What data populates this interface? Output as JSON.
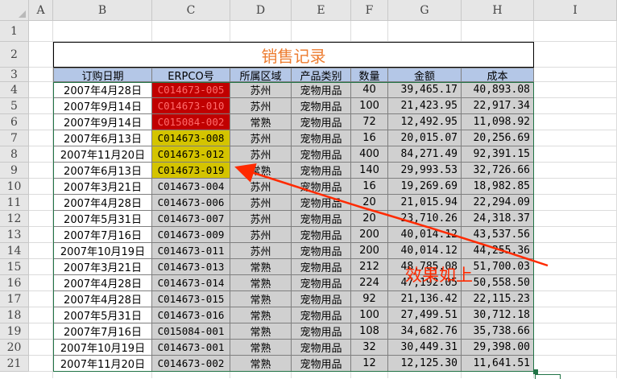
{
  "columns": [
    "A",
    "B",
    "C",
    "D",
    "E",
    "F",
    "G",
    "H",
    "I"
  ],
  "rows": [
    "1",
    "2",
    "3",
    "4",
    "5",
    "6",
    "7",
    "8",
    "9",
    "10",
    "11",
    "12",
    "13",
    "14",
    "15",
    "16",
    "17",
    "18",
    "19",
    "20",
    "21"
  ],
  "title": "销售记录",
  "headers": [
    "订购日期",
    "ERPCO号",
    "所属区域",
    "产品类别",
    "数量",
    "金额",
    "成本"
  ],
  "data": [
    [
      "2007年4月28日",
      "C014673-005",
      "苏州",
      "宠物用品",
      "40",
      "39,465.17",
      "40,893.08"
    ],
    [
      "2007年9月14日",
      "C014673-010",
      "苏州",
      "宠物用品",
      "100",
      "21,423.95",
      "22,917.34"
    ],
    [
      "2007年9月14日",
      "C015084-002",
      "常熟",
      "宠物用品",
      "72",
      "12,492.95",
      "11,098.92"
    ],
    [
      "2007年6月13日",
      "C014673-008",
      "苏州",
      "宠物用品",
      "16",
      "20,015.07",
      "20,256.69"
    ],
    [
      "2007年11月20日",
      "C014673-012",
      "苏州",
      "宠物用品",
      "400",
      "84,271.49",
      "92,391.15"
    ],
    [
      "2007年6月13日",
      "C014673-019",
      "常熟",
      "宠物用品",
      "140",
      "29,993.53",
      "32,726.66"
    ],
    [
      "2007年3月21日",
      "C014673-004",
      "苏州",
      "宠物用品",
      "16",
      "19,269.69",
      "18,982.85"
    ],
    [
      "2007年4月28日",
      "C014673-006",
      "苏州",
      "宠物用品",
      "20",
      "21,015.94",
      "22,294.09"
    ],
    [
      "2007年5月31日",
      "C014673-007",
      "苏州",
      "宠物用品",
      "20",
      "23,710.26",
      "24,318.37"
    ],
    [
      "2007年7月16日",
      "C014673-009",
      "苏州",
      "宠物用品",
      "200",
      "40,014.12",
      "43,537.56"
    ],
    [
      "2007年10月19日",
      "C014673-011",
      "苏州",
      "宠物用品",
      "200",
      "40,014.12",
      "44,255.36"
    ],
    [
      "2007年3月21日",
      "C014673-013",
      "常熟",
      "宠物用品",
      "212",
      "48,785.08",
      "51,700.03"
    ],
    [
      "2007年4月28日",
      "C014673-014",
      "常熟",
      "宠物用品",
      "224",
      "47,192.05",
      "50,558.50"
    ],
    [
      "2007年4月28日",
      "C014673-015",
      "常熟",
      "宠物用品",
      "92",
      "21,136.42",
      "22,115.23"
    ],
    [
      "2007年5月31日",
      "C014673-016",
      "常熟",
      "宠物用品",
      "100",
      "27,499.51",
      "30,712.18"
    ],
    [
      "2007年7月16日",
      "C015084-001",
      "常熟",
      "宠物用品",
      "108",
      "34,682.76",
      "35,738.66"
    ],
    [
      "2007年10月19日",
      "C014673-001",
      "常熟",
      "宠物用品",
      "32",
      "30,449.31",
      "29,398.00"
    ],
    [
      "2007年11月20日",
      "C014673-002",
      "常熟",
      "宠物用品",
      "12",
      "12,125.30",
      "11,641.51"
    ]
  ],
  "highlights": {
    "red": [
      0,
      1,
      2
    ],
    "yellow": [
      3,
      4,
      5
    ]
  },
  "colors": {
    "header_fill": "#b4c7e7",
    "body_fill": "#d0d0d0",
    "red_fill": "#c00000",
    "red_text": "#ff6b6b",
    "yellow_fill": "#d4c400",
    "title_color": "#ed7d31",
    "annotation_color": "#ff2a00",
    "selection": "#217346"
  },
  "annotation": "效果如上"
}
